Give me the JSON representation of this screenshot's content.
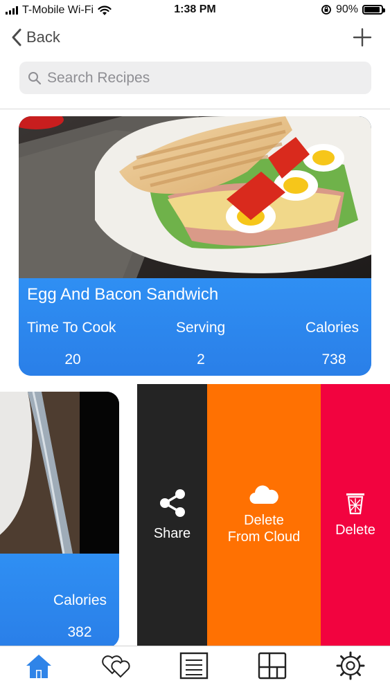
{
  "status_bar": {
    "carrier": "T-Mobile Wi-Fi",
    "time": "1:38 PM",
    "battery": "90%",
    "battery_level": 0.9
  },
  "nav": {
    "back_label": "Back",
    "add_icon": "plus-icon"
  },
  "search": {
    "placeholder": "Search Recipes",
    "value": ""
  },
  "recipes": [
    {
      "title": "Egg And Bacon Sandwich",
      "time_label": "Time To Cook",
      "serving_label": "Serving",
      "calories_label": "Calories",
      "time": "20",
      "serving": "2",
      "calories": "738"
    },
    {
      "calories_label": "Calories",
      "calories": "382"
    }
  ],
  "swipe_actions": {
    "share": "Share",
    "delete_cloud_line1": "Delete",
    "delete_cloud_line2": "From Cloud",
    "delete": "Delete"
  },
  "tabbar": {
    "items": [
      "home-icon",
      "favorites-icon",
      "list-icon",
      "grid-icon",
      "settings-icon"
    ],
    "active": "home-icon"
  },
  "colors": {
    "card_blue": "#2a8af0",
    "share_bg": "#242424",
    "cloud_bg": "#ff7102",
    "delete_bg": "#f2033f",
    "active_tab": "#2f84e8"
  }
}
